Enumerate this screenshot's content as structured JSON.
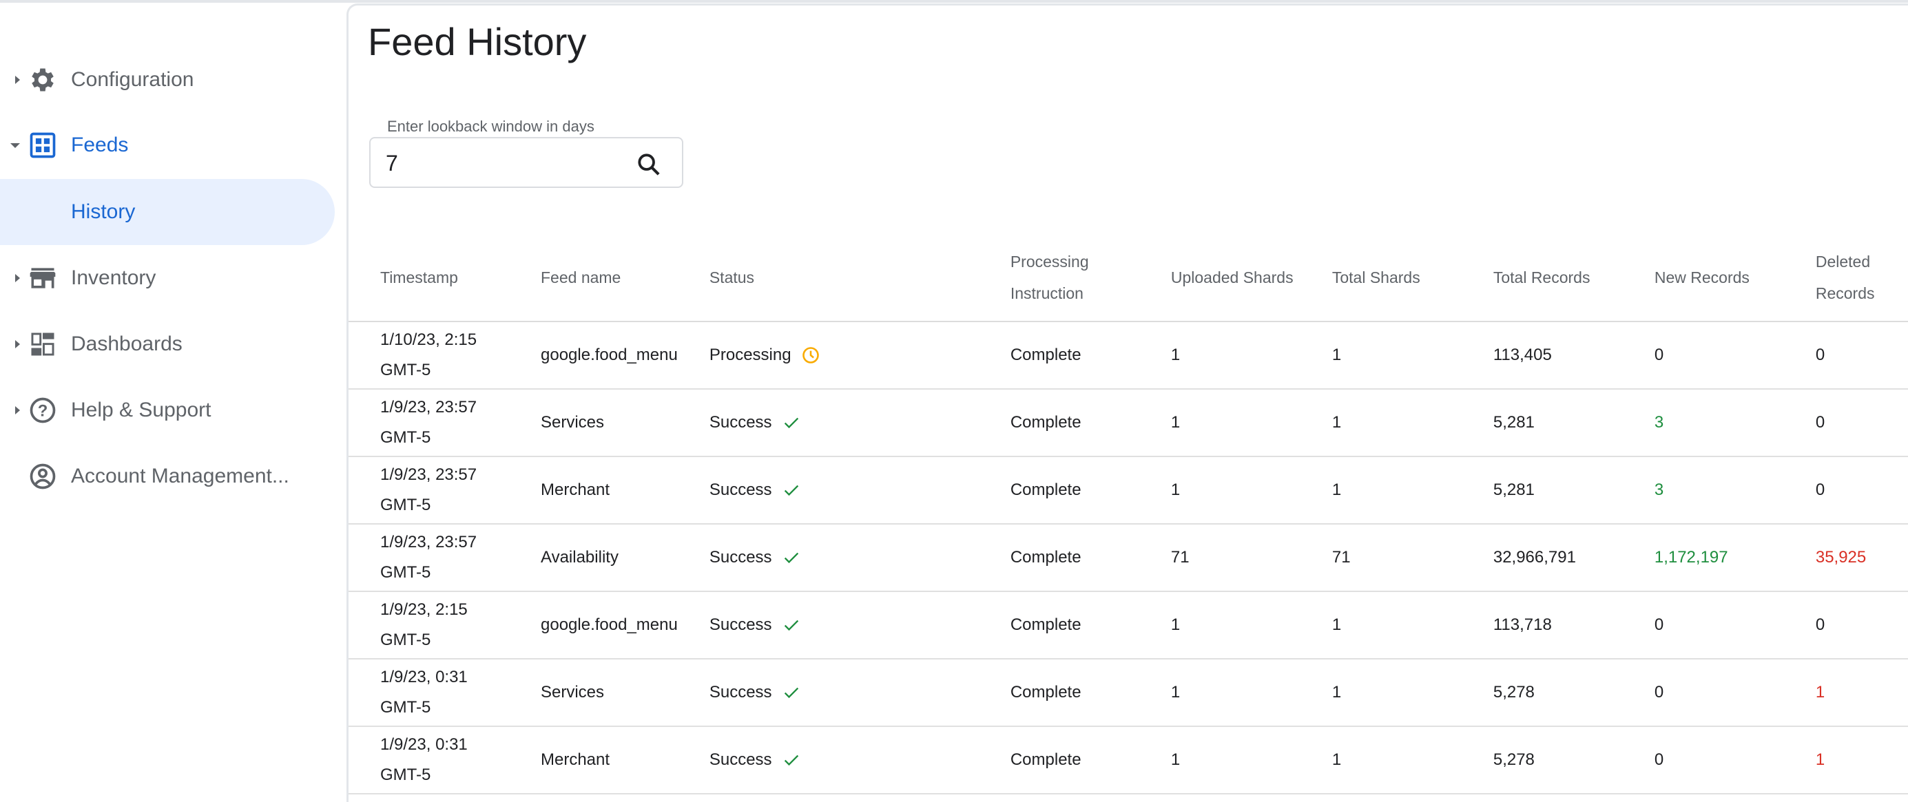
{
  "sidebar": {
    "items": [
      {
        "label": "Configuration",
        "icon": "gear-icon",
        "expanded": false
      },
      {
        "label": "Feeds",
        "icon": "grid-icon",
        "expanded": true,
        "active": true
      },
      {
        "label": "History",
        "sub": true,
        "selected": true
      },
      {
        "label": "Inventory",
        "icon": "store-icon",
        "expanded": false
      },
      {
        "label": "Dashboards",
        "icon": "dashboard-icon",
        "expanded": false
      },
      {
        "label": "Help & Support",
        "icon": "help-icon",
        "expanded": false
      },
      {
        "label": "Account Management...",
        "icon": "account-icon"
      }
    ]
  },
  "page": {
    "title": "Feed History"
  },
  "lookback": {
    "label": "Enter lookback window in days",
    "value": "7"
  },
  "colors": {
    "accent": "#1a67d2",
    "success": "#1e8e3e",
    "danger": "#d93025",
    "processing": "#f9ab00"
  },
  "table": {
    "headers": [
      "Timestamp",
      "Feed name",
      "Status",
      "Processing Instruction",
      "Uploaded Shards",
      "Total Shards",
      "Total Records",
      "New Records",
      "Deleted Records"
    ],
    "rows": [
      {
        "timestamp": "1/10/23, 2:15 GMT-5",
        "feed": "google.food_menu",
        "status": "Processing",
        "instruction": "Complete",
        "uploaded": "1",
        "total_shards": "1",
        "total_records": "113,405",
        "new": "0",
        "deleted": "0",
        "new_color": "",
        "deleted_color": ""
      },
      {
        "timestamp": "1/9/23, 23:57 GMT-5",
        "feed": "Services",
        "status": "Success",
        "instruction": "Complete",
        "uploaded": "1",
        "total_shards": "1",
        "total_records": "5,281",
        "new": "3",
        "deleted": "0",
        "new_color": "green",
        "deleted_color": ""
      },
      {
        "timestamp": "1/9/23, 23:57 GMT-5",
        "feed": "Merchant",
        "status": "Success",
        "instruction": "Complete",
        "uploaded": "1",
        "total_shards": "1",
        "total_records": "5,281",
        "new": "3",
        "deleted": "0",
        "new_color": "green",
        "deleted_color": ""
      },
      {
        "timestamp": "1/9/23, 23:57 GMT-5",
        "feed": "Availability",
        "status": "Success",
        "instruction": "Complete",
        "uploaded": "71",
        "total_shards": "71",
        "total_records": "32,966,791",
        "new": "1,172,197",
        "deleted": "35,925",
        "new_color": "green",
        "deleted_color": "red"
      },
      {
        "timestamp": "1/9/23, 2:15 GMT-5",
        "feed": "google.food_menu",
        "status": "Success",
        "instruction": "Complete",
        "uploaded": "1",
        "total_shards": "1",
        "total_records": "113,718",
        "new": "0",
        "deleted": "0",
        "new_color": "",
        "deleted_color": ""
      },
      {
        "timestamp": "1/9/23, 0:31 GMT-5",
        "feed": "Services",
        "status": "Success",
        "instruction": "Complete",
        "uploaded": "1",
        "total_shards": "1",
        "total_records": "5,278",
        "new": "0",
        "deleted": "1",
        "new_color": "",
        "deleted_color": "red"
      },
      {
        "timestamp": "1/9/23, 0:31 GMT-5",
        "feed": "Merchant",
        "status": "Success",
        "instruction": "Complete",
        "uploaded": "1",
        "total_shards": "1",
        "total_records": "5,278",
        "new": "0",
        "deleted": "1",
        "new_color": "",
        "deleted_color": "red"
      }
    ]
  }
}
